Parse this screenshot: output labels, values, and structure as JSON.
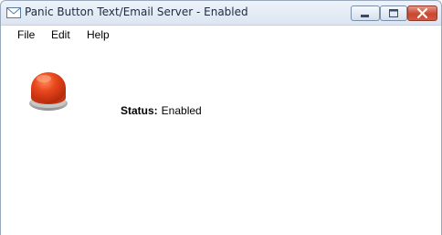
{
  "window": {
    "title": "Panic Button Text/Email Server - Enabled",
    "app_icon": "envelope-icon",
    "controls": {
      "minimize_icon": "minimize-icon",
      "maximize_icon": "maximize-icon",
      "close_icon": "close-icon"
    }
  },
  "menu": {
    "items": [
      {
        "label": "File"
      },
      {
        "label": "Edit"
      },
      {
        "label": "Help"
      }
    ]
  },
  "main": {
    "panic_button_icon": "red-panic-button-icon",
    "status_label": "Status:",
    "status_value": "Enabled"
  },
  "colors": {
    "button_red": "#e2431b",
    "close_red": "#c9462f",
    "title_bar": "#dbe5f1"
  }
}
